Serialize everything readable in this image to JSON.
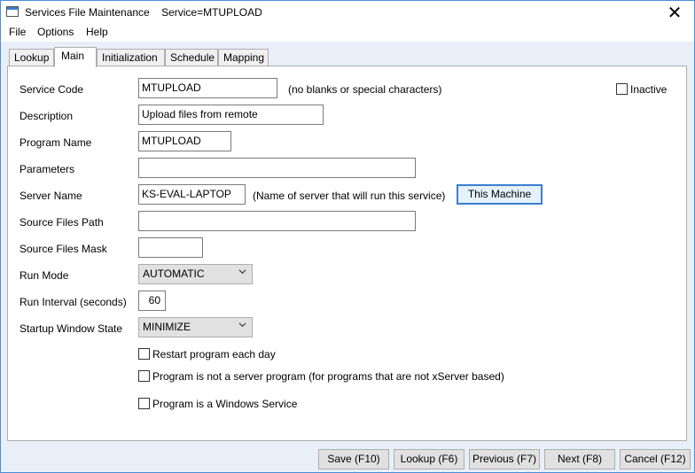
{
  "window": {
    "title": "Services File Maintenance    Service=MTUPLOAD",
    "close_symbol": "✕"
  },
  "menu": [
    "File",
    "Options",
    "Help"
  ],
  "tabs": [
    "Lookup",
    "Main",
    "Initialization",
    "Schedule",
    "Mapping"
  ],
  "active_tab": "Main",
  "form": {
    "service_code": {
      "label": "Service Code",
      "value": "MTUPLOAD",
      "hint": "(no blanks or special characters)"
    },
    "inactive": {
      "label": "Inactive",
      "checked": false
    },
    "description": {
      "label": "Description",
      "value": "Upload files from remote"
    },
    "program_name": {
      "label": "Program Name",
      "value": "MTUPLOAD"
    },
    "parameters": {
      "label": "Parameters",
      "value": ""
    },
    "server_name": {
      "label": "Server Name",
      "value": "KS-EVAL-LAPTOP",
      "hint": "(Name of server that will run this service)",
      "button": "This Machine"
    },
    "source_files_path": {
      "label": "Source Files Path",
      "value": ""
    },
    "source_files_mask": {
      "label": "Source Files Mask",
      "value": ""
    },
    "run_mode": {
      "label": "Run Mode",
      "value": "AUTOMATIC"
    },
    "run_interval": {
      "label": "Run Interval (seconds)",
      "value": "60"
    },
    "startup_window_state": {
      "label": "Startup Window State",
      "value": "MINIMIZE"
    },
    "restart_each_day": {
      "label": "Restart program each day",
      "checked": false
    },
    "not_server_program": {
      "label": "Program is not a server program (for programs that are not xServer based)",
      "checked": false
    },
    "windows_service": {
      "label": "Program is a Windows Service",
      "checked": false
    }
  },
  "buttons": {
    "save": "Save (F10)",
    "lookup": "Lookup (F6)",
    "previous": "Previous (F7)",
    "next": "Next (F8)",
    "cancel": "Cancel (F12)"
  }
}
